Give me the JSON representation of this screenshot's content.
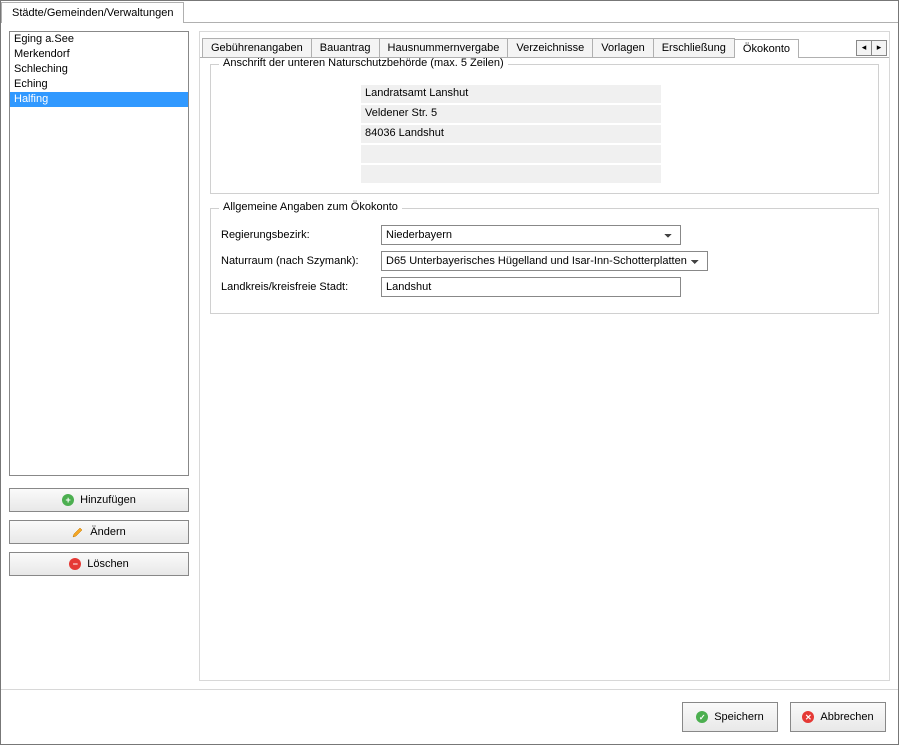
{
  "topTab": {
    "label": "Städte/Gemeinden/Verwaltungen"
  },
  "list": {
    "items": [
      {
        "label": "Eging a.See",
        "selected": false
      },
      {
        "label": "Merkendorf",
        "selected": false
      },
      {
        "label": "Schleching",
        "selected": false
      },
      {
        "label": "Eching",
        "selected": false
      },
      {
        "label": "Halfing",
        "selected": true
      }
    ]
  },
  "sideButtons": {
    "add": "Hinzufügen",
    "edit": "Ändern",
    "delete": "Löschen"
  },
  "innerTabs": {
    "items": [
      {
        "label": "Gebührenangaben",
        "active": false
      },
      {
        "label": "Bauantrag",
        "active": false
      },
      {
        "label": "Hausnummernvergabe",
        "active": false
      },
      {
        "label": "Verzeichnisse",
        "active": false
      },
      {
        "label": "Vorlagen",
        "active": false
      },
      {
        "label": "Erschließung",
        "active": false
      },
      {
        "label": "Ökokonto",
        "active": true
      }
    ],
    "navLeft": "◂",
    "navRight": "▸"
  },
  "addressGroup": {
    "title": "Anschrift der unteren Naturschutzbehörde (max. 5 Zeilen)",
    "lines": [
      "Landratsamt Lanshut",
      "Veldener Str. 5",
      "84036 Landshut",
      "",
      ""
    ]
  },
  "generalGroup": {
    "title": "Allgemeine Angaben zum Ökokonto",
    "rows": {
      "regierungsbezirk": {
        "label": "Regierungsbezirk:",
        "value": "Niederbayern"
      },
      "naturraum": {
        "label": "Naturraum (nach Szymank):",
        "value": "D65 Unterbayerisches Hügelland und Isar-Inn-Schotterplatten"
      },
      "landkreis": {
        "label": "Landkreis/kreisfreie Stadt:",
        "value": "Landshut"
      }
    }
  },
  "footer": {
    "save": "Speichern",
    "cancel": "Abbrechen"
  }
}
